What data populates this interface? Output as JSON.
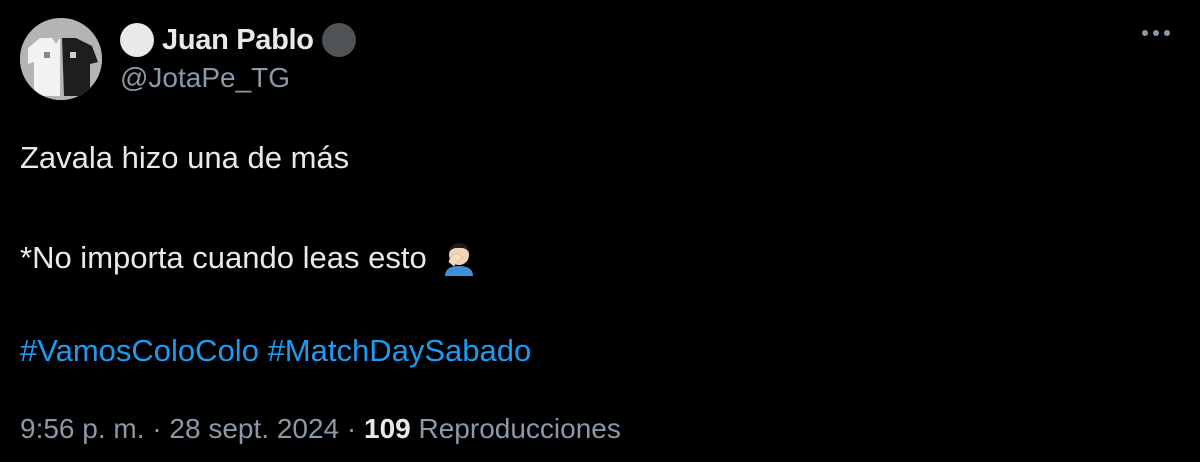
{
  "tweet": {
    "display_name": "Juan Pablo",
    "handle": "@JotaPe_TG",
    "text_line1": "Zavala hizo una de más",
    "text_line2": "*No importa cuando leas esto",
    "emoji_icon": "person-facepalming-icon",
    "hashtags": [
      "#VamosColoColo",
      "#MatchDaySabado"
    ],
    "time": "9:56 p. m.",
    "date": "28 sept. 2024",
    "separator": "·",
    "views_count": "109",
    "views_label": "Reproducciones"
  },
  "colors": {
    "background": "#000000",
    "text": "#e7e9ea",
    "secondary": "#8b98a5",
    "link": "#1d9bf0"
  }
}
